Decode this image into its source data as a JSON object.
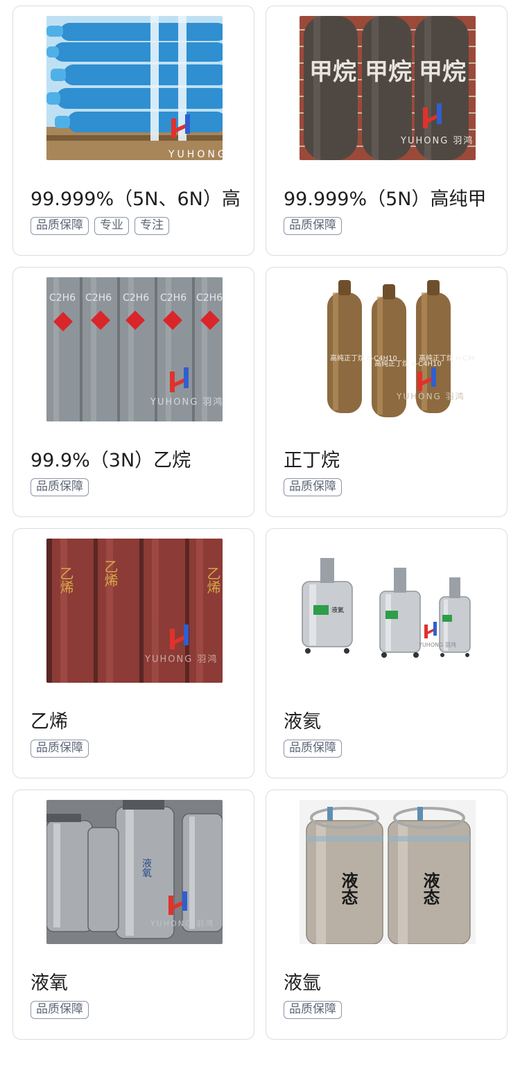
{
  "products": [
    {
      "title": "99.999%（5N、6N）高",
      "tags": [
        "品质保障",
        "专业",
        "专注"
      ],
      "watermark": "YUHONG",
      "photo_text": ""
    },
    {
      "title": "99.999%（5N）高纯甲",
      "tags": [
        "品质保障"
      ],
      "watermark": "YUHONG 羽鸿",
      "photo_text": "甲烷"
    },
    {
      "title": "99.9%（3N）乙烷",
      "tags": [
        "品质保障"
      ],
      "watermark": "YUHONG 羽鸿",
      "photo_text": "C2H6"
    },
    {
      "title": "正丁烷",
      "tags": [
        "品质保障"
      ],
      "watermark": "YUHONG 羽鸿",
      "photo_text": "高纯正丁烷 n-C4H10"
    },
    {
      "title": "乙烯",
      "tags": [
        "品质保障"
      ],
      "watermark": "YUHONG 羽鸿",
      "photo_text": "乙烯"
    },
    {
      "title": "液氦",
      "tags": [
        "品质保障"
      ],
      "watermark": "YUHONG 羽鸿",
      "photo_text": "液氦"
    },
    {
      "title": "液氧",
      "tags": [
        "品质保障"
      ],
      "watermark": "YUHONG 羽鸿",
      "photo_text": "液氧"
    },
    {
      "title": "液氩",
      "tags": [
        "品质保障"
      ],
      "watermark": "",
      "photo_text": "液态"
    }
  ],
  "colors": {
    "card_border": "#d9dce1",
    "tag_border": "#8a94a6",
    "tag_text": "#5e6778",
    "title_text": "#1e1e1e",
    "logo_red": "#e0322c",
    "logo_blue": "#2f5fd0"
  },
  "icons": {
    "logo": "yuhong-logo-icon"
  }
}
